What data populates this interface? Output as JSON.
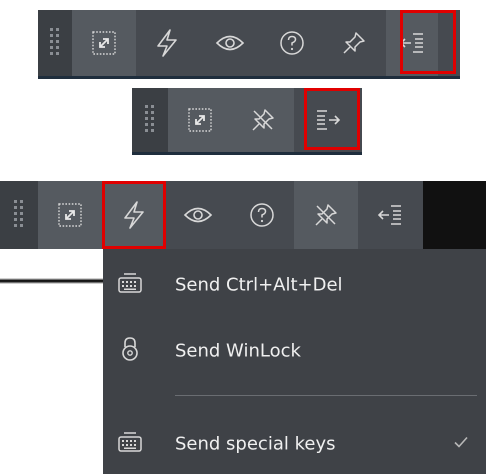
{
  "toolbar_expanded": {
    "buttons": [
      {
        "id": "grip",
        "icon": "grip-icon"
      },
      {
        "id": "fullscreen",
        "icon": "fullscreen-icon"
      },
      {
        "id": "actions",
        "icon": "lightning-icon"
      },
      {
        "id": "view",
        "icon": "eye-icon"
      },
      {
        "id": "help",
        "icon": "help-circle-icon"
      },
      {
        "id": "pin",
        "icon": "pin-icon"
      },
      {
        "id": "collapse",
        "icon": "collapse-left-icon",
        "highlighted": true
      }
    ]
  },
  "toolbar_collapsed": {
    "buttons": [
      {
        "id": "grip",
        "icon": "grip-icon"
      },
      {
        "id": "fullscreen",
        "icon": "fullscreen-icon"
      },
      {
        "id": "unpin",
        "icon": "unpin-icon"
      },
      {
        "id": "expand",
        "icon": "expand-right-icon",
        "highlighted": true
      }
    ]
  },
  "toolbar_menu": {
    "buttons": [
      {
        "id": "grip",
        "icon": "grip-icon"
      },
      {
        "id": "fullscreen",
        "icon": "fullscreen-icon"
      },
      {
        "id": "actions",
        "icon": "lightning-icon",
        "highlighted": true
      },
      {
        "id": "view",
        "icon": "eye-icon"
      },
      {
        "id": "help",
        "icon": "help-circle-icon"
      },
      {
        "id": "unpin",
        "icon": "unpin-icon"
      },
      {
        "id": "collapse",
        "icon": "collapse-left-icon"
      }
    ]
  },
  "menu": {
    "items": [
      {
        "label": "Send Ctrl+Alt+Del",
        "icon": "keyboard-icon"
      },
      {
        "label": "Send WinLock",
        "icon": "lock-icon"
      },
      {
        "label": "Send special keys",
        "icon": "keyboard-icon",
        "checked": true
      }
    ]
  },
  "colors": {
    "toolbar_bg": "#464a50",
    "button_light": "#555a60",
    "highlight": "#e00000",
    "menu_bg": "#3f4247",
    "icon": "#d8d8d8"
  }
}
